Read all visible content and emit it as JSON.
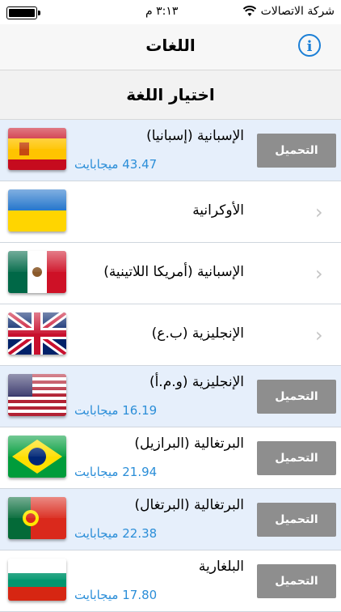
{
  "status": {
    "carrier": "شركة الاتصالات",
    "time": "٣:١٣ م"
  },
  "nav": {
    "title": "اللغات",
    "info_label": "i"
  },
  "section": {
    "title": "اختيار اللغة"
  },
  "rows": [
    {
      "name": "الإسبانية (إسبانيا)",
      "size": "43.47 ميجابايت",
      "button": "التحميل",
      "flag": "spain-flag",
      "highlight": true
    },
    {
      "name": "الأوكرانية",
      "flag": "ukraine-flag",
      "highlight": false
    },
    {
      "name": "الإسبانية (أمريكا اللاتينية)",
      "flag": "mexico-flag",
      "highlight": false
    },
    {
      "name": "الإنجليزية (ب.ع)",
      "flag": "uk-flag",
      "highlight": false
    },
    {
      "name": "الإنجليزية (و.م.أ)",
      "size": "16.19 ميجابايت",
      "button": "التحميل",
      "flag": "usa-flag",
      "highlight": true
    },
    {
      "name": "البرتغالية (البرازيل)",
      "size": "21.94 ميجابايت",
      "button": "التحميل",
      "flag": "brazil-flag",
      "highlight": false
    },
    {
      "name": "البرتغالية (البرتغال)",
      "size": "22.38 ميجابايت",
      "button": "التحميل",
      "flag": "portugal-flag",
      "highlight": true
    },
    {
      "name": "البلغارية",
      "size": "17.80 ميجابايت",
      "button": "التحميل",
      "flag": "bulgaria-flag",
      "highlight": false
    }
  ],
  "colors": {
    "accent": "#1b7fd6",
    "size_text": "#2b8ed8",
    "button_bg": "#8e8e8e",
    "highlight_row": "#e6effb"
  }
}
